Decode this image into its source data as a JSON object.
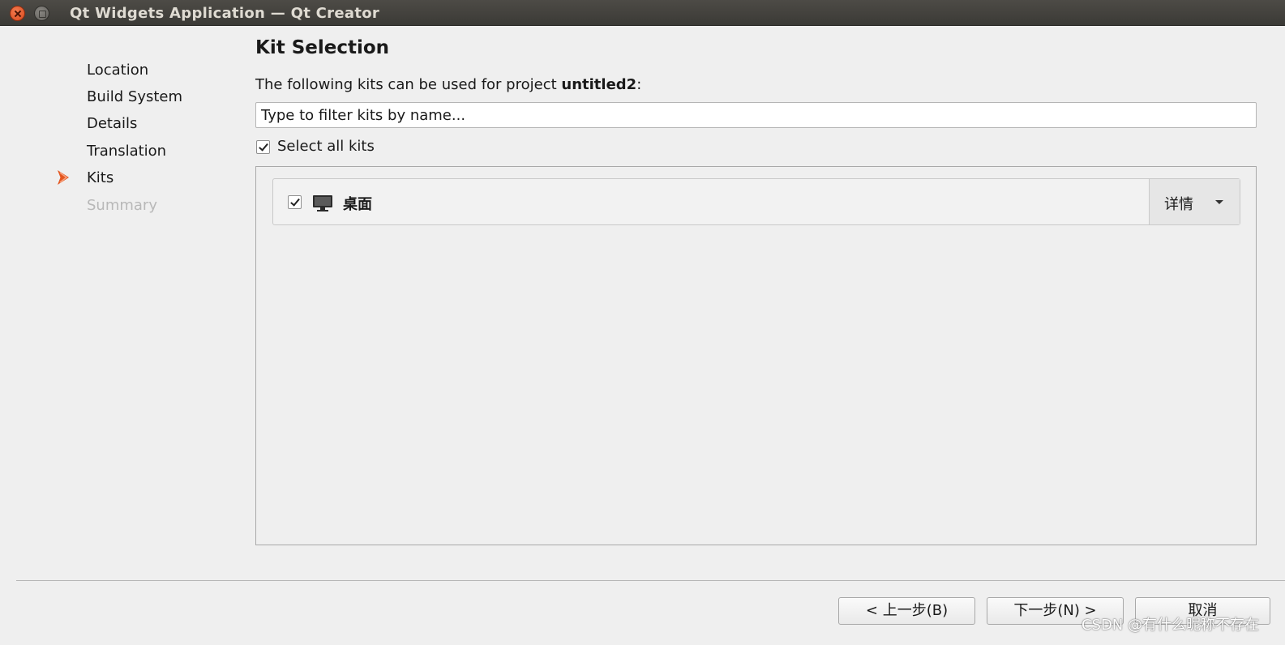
{
  "window": {
    "title": "Qt Widgets Application — Qt Creator"
  },
  "wizard": {
    "steps": [
      {
        "label": "Location",
        "state": "done"
      },
      {
        "label": "Build System",
        "state": "done"
      },
      {
        "label": "Details",
        "state": "done"
      },
      {
        "label": "Translation",
        "state": "done"
      },
      {
        "label": "Kits",
        "state": "current"
      },
      {
        "label": "Summary",
        "state": "pending"
      }
    ],
    "current_step_indicator": "chevron-right-icon"
  },
  "main": {
    "title": "Kit Selection",
    "intro_prefix": "The following kits can be used for project ",
    "project_name": "untitled2",
    "intro_suffix": ":",
    "filter_placeholder": "Type to filter kits by name...",
    "filter_value": "",
    "select_all": {
      "label": "Select all kits",
      "checked": true
    },
    "kits": [
      {
        "name": "桌面",
        "checked": true,
        "icon": "desktop-monitor-icon",
        "details_label": "详情"
      }
    ]
  },
  "footer": {
    "back_label": "< 上一步(B)",
    "next_label": "下一步(N) >",
    "cancel_label": "取消"
  },
  "watermark": "CSDN @有什么昵称不存在",
  "colors": {
    "accent": "#e4561f",
    "titlebar": "#3f3e3a",
    "background": "#efefef"
  }
}
